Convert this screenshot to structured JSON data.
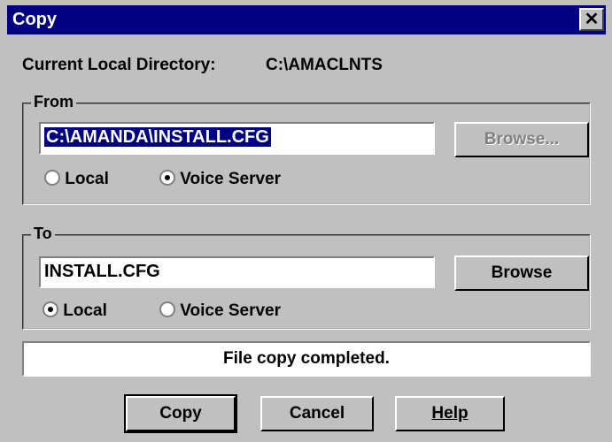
{
  "window": {
    "title": "Copy",
    "close_glyph": "✕"
  },
  "current_dir": {
    "label": "Current Local Directory:",
    "value": "C:\\AMACLNTS"
  },
  "from_group": {
    "legend": "From",
    "path": "C:\\AMANDA\\INSTALL.CFG",
    "browse_label": "Browse...",
    "radio_local": "Local",
    "radio_voice": "Voice Server",
    "selected": "Voice Server"
  },
  "to_group": {
    "legend": "To",
    "path": "INSTALL.CFG",
    "browse_label": "Browse",
    "radio_local": "Local",
    "radio_voice": "Voice Server",
    "selected": "Local"
  },
  "status": {
    "message": "File copy completed."
  },
  "buttons": {
    "copy": "Copy",
    "cancel": "Cancel",
    "help": "Help"
  },
  "colors": {
    "titlebar": "#000080",
    "dialog": "#c0c0c0",
    "selection": "#000080"
  }
}
